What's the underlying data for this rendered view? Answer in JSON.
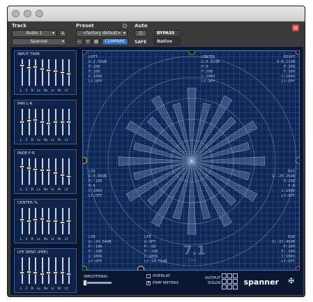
{
  "header": {
    "track_label": "Track",
    "preset_label": "Preset",
    "auto_label": "Auto",
    "track_value": "Audio 1",
    "track_channel": "a",
    "plugin_name": "Spanner",
    "preset_value": "<factory default>",
    "compare_label": "COMPARE",
    "bypass_label": "BYPASS",
    "safe_label": "SAFE",
    "native_label": "Native",
    "stepper_minus": "−",
    "stepper_plus": "+"
  },
  "panels": [
    {
      "title": "INPUT TRIM",
      "channels": [
        "L",
        "C",
        "R",
        "Ls",
        "Rs",
        "Lr",
        "Rr",
        "Lf"
      ],
      "levels": [
        0.2,
        0.3,
        0.25,
        0.35,
        0.4,
        0.45,
        0.5,
        0.55
      ]
    },
    {
      "title": "PAN L-R",
      "channels": [
        "L",
        "C",
        "R",
        "Ls",
        "Rs",
        "Lr",
        "Rr",
        "Lf"
      ],
      "levels": [
        0.5,
        0.45,
        0.4,
        0.5,
        0.55,
        0.5,
        0.5,
        0.5
      ]
    },
    {
      "title": "FADE F-R",
      "channels": [
        "L",
        "C",
        "R",
        "Ls",
        "Rs",
        "Lr",
        "Rr",
        "Lf"
      ],
      "levels": [
        0.3,
        0.35,
        0.4,
        0.45,
        0.45,
        0.55,
        0.65,
        0.7
      ]
    },
    {
      "title": "CENTER %",
      "channels": [
        "L",
        "C",
        "R",
        "Ls",
        "Rs",
        "Lr",
        "Rr",
        "Lf"
      ],
      "levels": [
        0.45,
        0.5,
        0.45,
        0.4,
        0.5,
        0.5,
        0.55,
        0.5
      ]
    },
    {
      "title": "LFE SEND (PRE)",
      "channels": [
        "L",
        "C",
        "R",
        "Ls",
        "Rs",
        "Lr",
        "Rr",
        "Lf"
      ],
      "levels": [
        0.6,
        0.55,
        0.6,
        0.65,
        0.6,
        0.6,
        0.6,
        0.65
      ]
    }
  ],
  "readouts": {
    "left": "LEFT\nG:2.50dB\nP:100\nF:100\nC:100X\nLf:OFF",
    "center": "CENTER\nG:6.82dB\nP:0\nF:100\nC:100X\nLf:OFF",
    "right": "RIGHT\nG:0.22dB\nP:100\nF:100\nC:100X\nLf:OFF",
    "ls": "LSS\nG:0.00dB\nP:-100\nF:0\nC:100X\nLf:OFF",
    "rs": "RSS\nG:-20.26dB\nP:100\nF:0\nC:100X\nLf:OFF",
    "lsr": "LSR\nG:-34.54dB\nP:-100\nF:-100\nC:100X\nLf:OFF",
    "lfe": "LFE\nG:OFF\nP:-50\nF:-100\nC:100X\nLf:14.75dB",
    "rsr": "RSR\nG:-17.40dB\nP:100\nF:-100\nC:100X\nLf:OFF"
  },
  "format_label": "7.1",
  "format_sub": "2.0.0",
  "bottom": {
    "smoothing_label": "SMOOTHING",
    "overlay_label": "OVERLAY",
    "pimp_meters_label": "PIMP METERS",
    "output_solos_label": "OUTPUT\nSOLOS",
    "pimp_meters_checked": true,
    "logo_text": "spanner"
  }
}
